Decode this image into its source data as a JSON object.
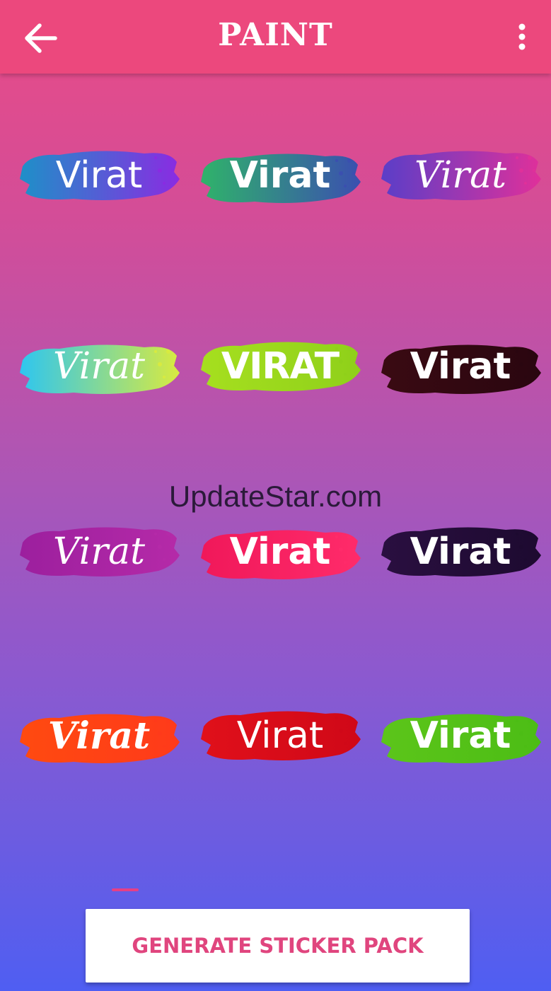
{
  "app_bar": {
    "title": "PAINT",
    "back_icon": "arrow-left-icon",
    "menu_icon": "more-vert-icon",
    "background_color": "#ec487d"
  },
  "stickers": [
    {
      "label": "Virat",
      "font": "sans",
      "colors": [
        "#1e90c8",
        "#8a2be2"
      ]
    },
    {
      "label": "Virat",
      "font": "sans-bold",
      "colors": [
        "#2fb36a",
        "#3b4fb0"
      ]
    },
    {
      "label": "Virat",
      "font": "script",
      "colors": [
        "#5a3ec8",
        "#e0309a"
      ]
    },
    {
      "label": "Virat",
      "font": "script",
      "colors": [
        "#2ec6f0",
        "#d8ea40"
      ]
    },
    {
      "label": "Virat",
      "font": "block",
      "colors": [
        "#a6df1f",
        "#8fd01a"
      ]
    },
    {
      "label": "Virat",
      "font": "sans-bold",
      "colors": [
        "#3a0a12",
        "#2a0610"
      ]
    },
    {
      "label": "Virat",
      "font": "script",
      "colors": [
        "#9c1f9e",
        "#b52aa8"
      ]
    },
    {
      "label": "Virat",
      "font": "sans-bold",
      "colors": [
        "#f0185a",
        "#ff2b6a"
      ]
    },
    {
      "label": "Virat",
      "font": "serif-bold",
      "colors": [
        "#2a0f40",
        "#1d0a30"
      ]
    },
    {
      "label": "Virat",
      "font": "serif-bold-italic",
      "colors": [
        "#ff4a10",
        "#ff3a1a"
      ]
    },
    {
      "label": "Virat",
      "font": "sans",
      "colors": [
        "#e0101a",
        "#d00818"
      ]
    },
    {
      "label": "Virat",
      "font": "sans-bold",
      "colors": [
        "#5cc51a",
        "#4cbd15"
      ]
    }
  ],
  "watermark": "UpdateStar.com",
  "generate_button": {
    "label": "GENERATE STICKER PACK",
    "text_color": "#e0457e"
  }
}
